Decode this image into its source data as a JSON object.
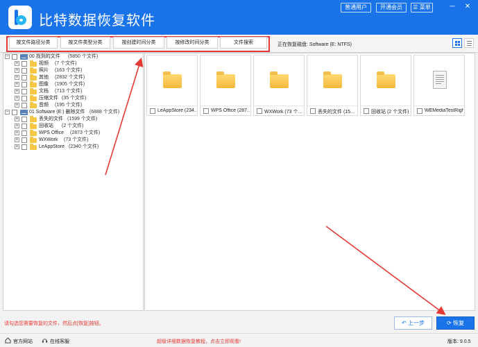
{
  "app": {
    "title": "比特数据恢复软件",
    "btn_user": "普通用户",
    "btn_vip": "开通会员",
    "btn_menu": "菜单",
    "min": "─",
    "close": "✕"
  },
  "toolbar": {
    "categories": [
      "按文件路径分类",
      "按文件类型分类",
      "按创建时间分类",
      "按修改时间分类",
      "文件搜索"
    ],
    "disk_prefix": "正在恢复磁盘:",
    "disk_name": "Software (E: NTFS)"
  },
  "tree": {
    "groups": [
      {
        "label": "00 找到的文件",
        "count": "(5850 个文件)",
        "children": [
          {
            "label": "视频",
            "count": "(7 个文件)"
          },
          {
            "label": "照片",
            "count": "(163 个文件)"
          },
          {
            "label": "其他",
            "count": "(2832 个文件)"
          },
          {
            "label": "图像",
            "count": "(1905 个文件)"
          },
          {
            "label": "文档",
            "count": "(713 个文件)"
          },
          {
            "label": "压缩文件",
            "count": "(35 个文件)"
          },
          {
            "label": "音频",
            "count": "(195 个文件)"
          }
        ]
      },
      {
        "label": "01 Software (E:) 删除文件",
        "count": "(6888 个文件)",
        "children": [
          {
            "label": "丢失的文件",
            "count": "(1599 个文件)"
          },
          {
            "label": "回收站",
            "count": "(2 个文件)"
          },
          {
            "label": "WPS Office",
            "count": "(2873 个文件)"
          },
          {
            "label": "WXWork",
            "count": "(73 个文件)"
          },
          {
            "label": "LeAppStore",
            "count": "(2340 个文件)"
          }
        ]
      }
    ]
  },
  "files": [
    {
      "name": "LeAppStore  (234...",
      "icon": "folder-icon"
    },
    {
      "name": "WPS Office  (287...",
      "icon": "folder-icon"
    },
    {
      "name": "WXWork  (73 个...",
      "icon": "folder-icon"
    },
    {
      "name": "丢失的文件  (15...",
      "icon": "folder-icon"
    },
    {
      "name": "回收站  (2 个文件)",
      "icon": "folder-icon"
    },
    {
      "name": "WEMediaTestRigh...",
      "icon": "document-icon"
    }
  ],
  "bottom": {
    "hint": "请勾选您需要恢复的文件，然后点[恢复]按钮。",
    "prev": "上一步",
    "recover": "恢复",
    "official_site": "官方网站",
    "online_service": "在线客服",
    "promo": "超级详细数据恢复教程，点击立即观看!",
    "version": "版本: 9.0.5"
  },
  "colors": {
    "brand": "#1a73e8",
    "highlight": "#e53935",
    "folder": "#f6c744"
  }
}
